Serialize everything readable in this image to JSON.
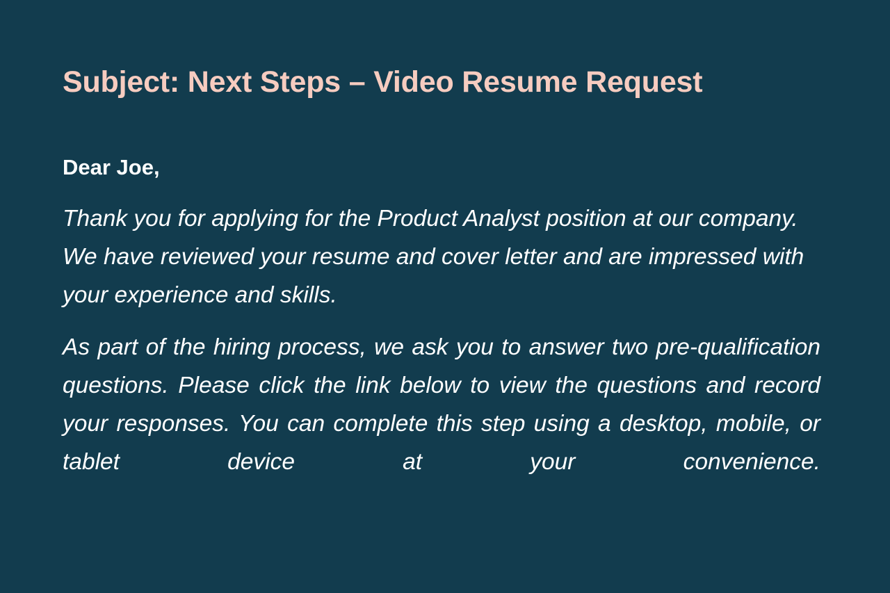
{
  "theme": {
    "background_color": "#123c4e",
    "accent_color": "#f6ccc0",
    "text_color": "#ffffff"
  },
  "email": {
    "subject": "Subject: Next Steps – Video Resume Request",
    "greeting": "Dear Joe,",
    "paragraphs": [
      {
        "text": "Thank you for applying for the Product Analyst position at our company. We have reviewed your resume and cover letter and are impressed with your experience and skills.",
        "align": "left"
      },
      {
        "text": "As part of the hiring process, we ask you to answer two pre-qualification questions. Please click the link below to view the questions and record your responses. You can complete this step using a desktop, mobile, or tablet device at your convenience.",
        "align": "justify"
      }
    ]
  }
}
